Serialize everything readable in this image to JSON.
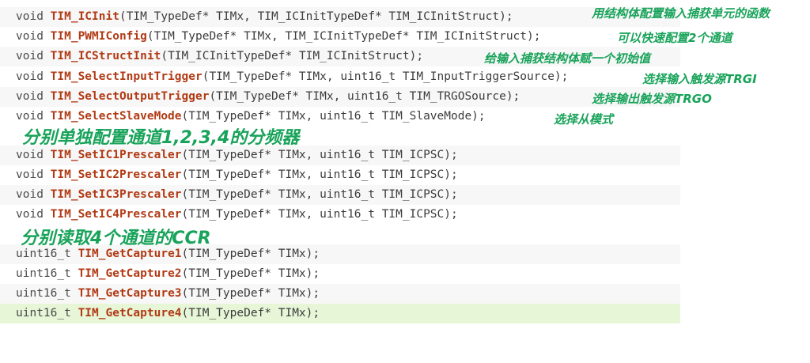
{
  "code_lines": [
    {
      "kw": "void ",
      "fn": "TIM_ICInit",
      "rest": "(TIM_TypeDef* TIMx, TIM_ICInitTypeDef* TIM_ICInitStruct);"
    },
    {
      "kw": "void ",
      "fn": "TIM_PWMIConfig",
      "rest": "(TIM_TypeDef* TIMx, TIM_ICInitTypeDef* TIM_ICInitStruct);"
    },
    {
      "kw": "void ",
      "fn": "TIM_ICStructInit",
      "rest": "(TIM_ICInitTypeDef* TIM_ICInitStruct);"
    },
    {
      "kw": "void ",
      "fn": "TIM_SelectInputTrigger",
      "rest": "(TIM_TypeDef* TIMx, uint16_t TIM_InputTriggerSource);"
    },
    {
      "kw": "void ",
      "fn": "TIM_SelectOutputTrigger",
      "rest": "(TIM_TypeDef* TIMx, uint16_t TIM_TRGOSource);"
    },
    {
      "kw": "void ",
      "fn": "TIM_SelectSlaveMode",
      "rest": "(TIM_TypeDef* TIMx, uint16_t TIM_SlaveMode);"
    },
    {
      "kw": "void ",
      "fn": "TIM_SetIC1Prescaler",
      "rest": "(TIM_TypeDef* TIMx, uint16_t TIM_ICPSC);"
    },
    {
      "kw": "void ",
      "fn": "TIM_SetIC2Prescaler",
      "rest": "(TIM_TypeDef* TIMx, uint16_t TIM_ICPSC);"
    },
    {
      "kw": "void ",
      "fn": "TIM_SetIC3Prescaler",
      "rest": "(TIM_TypeDef* TIMx, uint16_t TIM_ICPSC);"
    },
    {
      "kw": "void ",
      "fn": "TIM_SetIC4Prescaler",
      "rest": "(TIM_TypeDef* TIMx, uint16_t TIM_ICPSC);"
    },
    {
      "kw": "uint16_t ",
      "fn": "TIM_GetCapture1",
      "rest": "(TIM_TypeDef* TIMx);"
    },
    {
      "kw": "uint16_t ",
      "fn": "TIM_GetCapture2",
      "rest": "(TIM_TypeDef* TIMx);"
    },
    {
      "kw": "uint16_t ",
      "fn": "TIM_GetCapture3",
      "rest": "(TIM_TypeDef* TIMx);"
    },
    {
      "kw": "uint16_t ",
      "fn": "TIM_GetCapture4",
      "rest": "(TIM_TypeDef* TIMx);"
    }
  ],
  "annotations": {
    "ic_init": "用结构体配置输入捕获单元的函数",
    "pwmi_config": "可以快速配置2个通道",
    "ic_struct_init": "给输入捕获结构体赋一个初始值",
    "input_trigger": "选择输入触发源TRGI",
    "output_trigger": "选择输出触发源TRGO",
    "slave_mode": "选择从模式",
    "prescaler_group": "分别单独配置通道1,2,3,4的分频器",
    "capture_group": "分别读取4个通道的CCR"
  },
  "colors": {
    "annotation_ink": "#19a35a",
    "function_name": "#b13a14",
    "current_line_highlight": "#e6f6d7"
  }
}
